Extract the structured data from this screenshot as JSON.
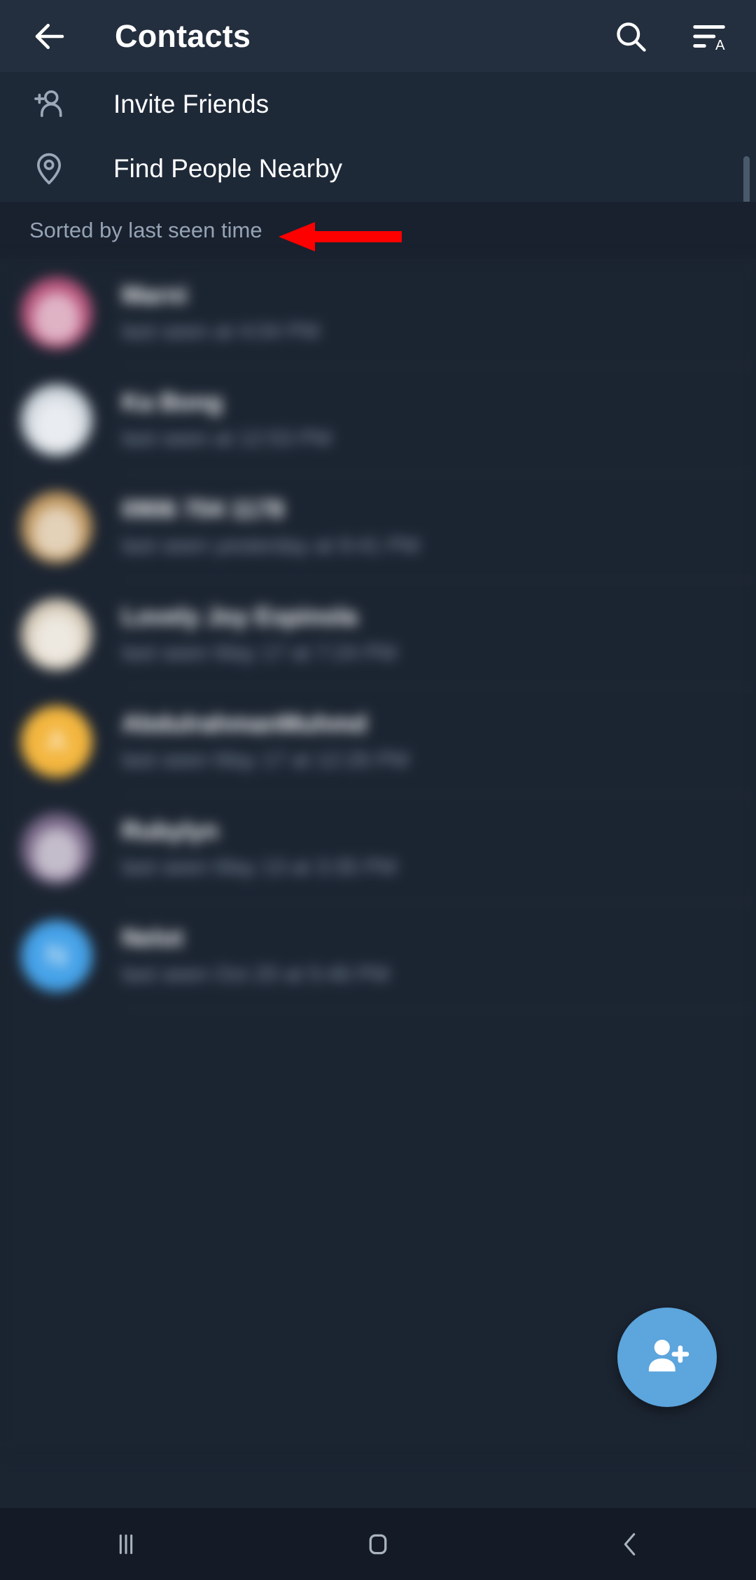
{
  "appbar": {
    "title": "Contacts",
    "back_icon": "arrow-left-icon",
    "search_icon": "search-icon",
    "sort_icon": "sort-alpha-icon"
  },
  "actions": [
    {
      "label": "Invite Friends",
      "icon": "person-add-icon"
    },
    {
      "label": "Find People Nearby",
      "icon": "location-pin-icon"
    }
  ],
  "list_header": {
    "text": "Sorted by last seen time"
  },
  "contacts": [
    {
      "name": "Marni",
      "status": "last seen at 4:04 PM",
      "avatar_type": "photo",
      "avatar_color": "#b9567d"
    },
    {
      "name": "Ka Bong",
      "status": "last seen at 12:53 PM",
      "avatar_type": "photo",
      "avatar_color": "#cfd6dd"
    },
    {
      "name": "0906 704 1178",
      "status": "last seen yesterday at 9:41 PM",
      "avatar_type": "photo",
      "avatar_color": "#c29a63"
    },
    {
      "name": "Lovely Joy Espinola",
      "status": "last seen May 17 at 7:24 PM",
      "avatar_type": "photo",
      "avatar_color": "#d8cdbb"
    },
    {
      "name": "AbdulrahmanMuhmd",
      "status": "last seen May 17 at 12:26 PM",
      "avatar_type": "initial",
      "avatar_initial": "A",
      "avatar_color": "#f3b63f"
    },
    {
      "name": "Rubylyn",
      "status": "last seen May 13 at 3:35 PM",
      "avatar_type": "photo",
      "avatar_color": "#7b6a8a"
    },
    {
      "name": "Nelot",
      "status": "last seen Oct 20 at 5:46 PM",
      "avatar_type": "initial",
      "avatar_initial": "N",
      "avatar_color": "#46a2e8"
    }
  ],
  "fab": {
    "icon": "person-add-icon",
    "color": "#5ca5dd"
  },
  "annotation": {
    "type": "arrow-left",
    "color": "#fe0000",
    "points_to": "Find People Nearby"
  },
  "navbar": [
    {
      "icon": "recents-icon"
    },
    {
      "icon": "home-icon"
    },
    {
      "icon": "back-icon"
    }
  ]
}
